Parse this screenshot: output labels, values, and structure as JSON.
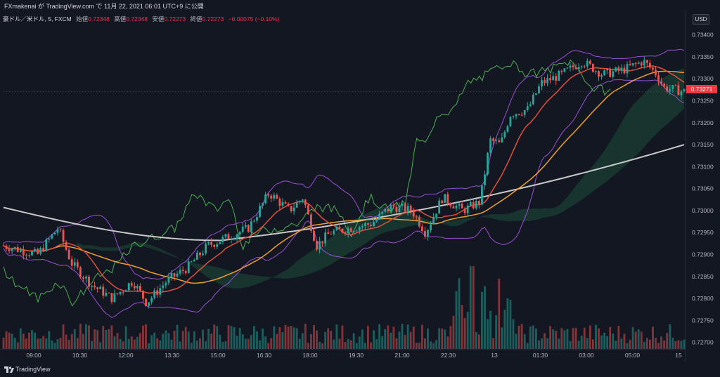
{
  "header": {
    "publisher": "FXmakenai が TradingView.com で 11月 22, 2021 06:01 UTC+9 に公開"
  },
  "legend": {
    "symbol": "豪ドル／米ドル, 5, FXCM",
    "open_label": "始値",
    "open": "0.72348",
    "high_label": "高値",
    "high": "0.72348",
    "low_label": "安値",
    "low": "0.72273",
    "close_label": "終値",
    "close": "0.72273",
    "change": "−0.00075 (−0.10%)"
  },
  "currency_button": "USD",
  "last_price_badge": "0.73271",
  "price_axis_labels": [
    "0.73400",
    "0.73350",
    "0.73300",
    "0.73250",
    "0.73200",
    "0.73150",
    "0.73100",
    "0.73050",
    "0.73000",
    "0.72950",
    "0.72900",
    "0.72850",
    "0.72800",
    "0.72750",
    "0.72700"
  ],
  "time_axis_labels": [
    "09:00",
    "10:30",
    "12:00",
    "13:30",
    "15:00",
    "16:30",
    "18:00",
    "19:30",
    "21:00",
    "22:30",
    "13",
    "01:30",
    "03:00",
    "05:00",
    "15"
  ],
  "footer": {
    "brand": "TradingView"
  },
  "colors": {
    "background": "#131722",
    "up": "#26a69a",
    "down": "#ef5350",
    "ma_white": "#c8c8c8",
    "ma_orange": "#f0a030",
    "ma_red": "#e0503a",
    "bollinger": "#9c4fd4",
    "chikou": "#4caf50",
    "cloud_green": "#1e4d3a",
    "cloud_red": "#4d1e2a"
  },
  "chart_data": {
    "type": "candlestick",
    "symbol": "豪ドル／米ドル, 5, FXCM",
    "y_range": [
      0.72685,
      0.73425
    ],
    "x_labels": [
      "09:00",
      "10:30",
      "12:00",
      "13:30",
      "15:00",
      "16:30",
      "18:00",
      "19:30",
      "21:00",
      "22:30",
      "13",
      "01:30",
      "03:00",
      "05:00",
      "15"
    ],
    "close_anchors": [
      [
        0,
        0.7292
      ],
      [
        0.05,
        0.729
      ],
      [
        0.08,
        0.7296
      ],
      [
        0.1,
        0.7288
      ],
      [
        0.13,
        0.7283
      ],
      [
        0.16,
        0.728
      ],
      [
        0.19,
        0.7284
      ],
      [
        0.21,
        0.7279
      ],
      [
        0.24,
        0.7284
      ],
      [
        0.27,
        0.7287
      ],
      [
        0.3,
        0.7292
      ],
      [
        0.33,
        0.7294
      ],
      [
        0.36,
        0.7296
      ],
      [
        0.39,
        0.7304
      ],
      [
        0.42,
        0.73
      ],
      [
        0.44,
        0.7303
      ],
      [
        0.46,
        0.7292
      ],
      [
        0.48,
        0.7295
      ],
      [
        0.51,
        0.7296
      ],
      [
        0.54,
        0.7297
      ],
      [
        0.57,
        0.7301
      ],
      [
        0.6,
        0.73
      ],
      [
        0.62,
        0.7295
      ],
      [
        0.645,
        0.7303
      ],
      [
        0.675,
        0.73
      ],
      [
        0.7,
        0.7302
      ],
      [
        0.715,
        0.7316
      ],
      [
        0.73,
        0.7315
      ],
      [
        0.745,
        0.7322
      ],
      [
        0.77,
        0.7323
      ],
      [
        0.79,
        0.7329
      ],
      [
        0.82,
        0.7331
      ],
      [
        0.85,
        0.7334
      ],
      [
        0.88,
        0.7331
      ],
      [
        0.91,
        0.7332
      ],
      [
        0.94,
        0.7334
      ],
      [
        0.96,
        0.7331
      ],
      [
        0.97,
        0.7328
      ],
      [
        1.0,
        0.73271
      ]
    ]
  }
}
